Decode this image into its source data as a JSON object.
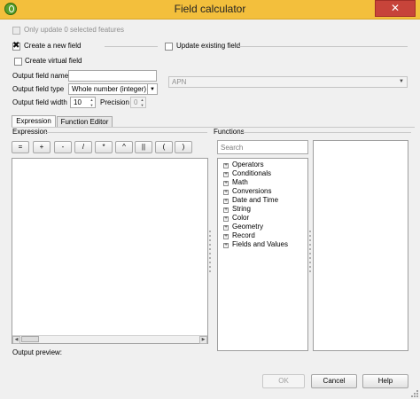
{
  "window": {
    "title": "Field calculator",
    "close_glyph": "✕"
  },
  "top": {
    "only_update_label": "Only update 0 selected features",
    "create_new_label": "Create a new field",
    "update_existing_label": "Update existing field",
    "create_virtual_label": "Create virtual field",
    "output_field_name_label": "Output field name",
    "output_field_name_value": "",
    "output_field_type_label": "Output field type",
    "output_field_type_value": "Whole number (integer)",
    "output_field_width_label": "Output field width",
    "output_field_width_value": "10",
    "precision_label": "Precision",
    "precision_value": "0",
    "existing_field_value": "APN"
  },
  "tabs": [
    {
      "label": "Expression",
      "active": true
    },
    {
      "label": "Function Editor",
      "active": false
    }
  ],
  "expression": {
    "section_label": "Expression",
    "operators": [
      "=",
      "+",
      "-",
      "/",
      "*",
      "^",
      "||",
      "(",
      ")"
    ],
    "output_preview_label": "Output preview:"
  },
  "functions": {
    "section_label": "Functions",
    "search_placeholder": "Search",
    "groups": [
      "Operators",
      "Conditionals",
      "Math",
      "Conversions",
      "Date and Time",
      "String",
      "Color",
      "Geometry",
      "Record",
      "Fields and Values"
    ]
  },
  "buttons": {
    "ok": "OK",
    "cancel": "Cancel",
    "help": "Help"
  }
}
